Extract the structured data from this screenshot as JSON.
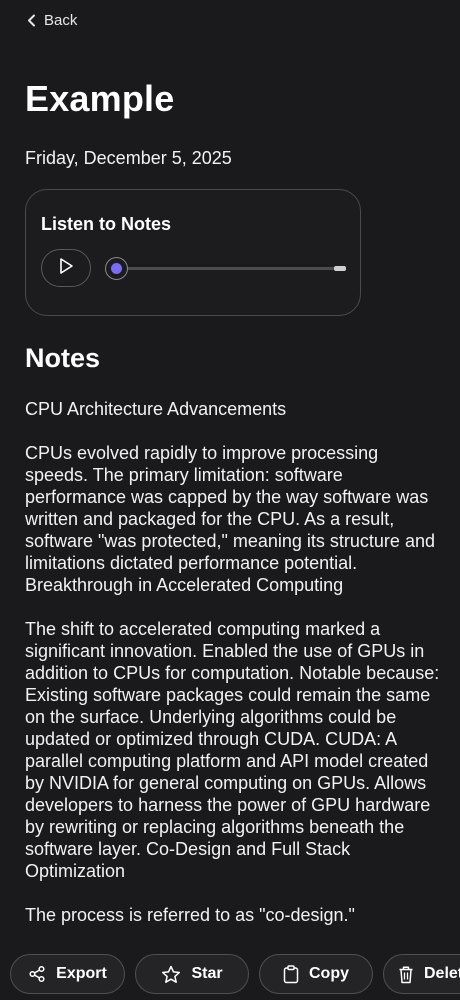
{
  "header": {
    "back_label": "Back"
  },
  "note": {
    "title": "Example",
    "date": "Friday, December 5, 2025"
  },
  "audio": {
    "title": "Listen to Notes",
    "progress": 0
  },
  "notes": {
    "heading": "Notes",
    "paragraphs": [
      "CPU Architecture Advancements",
      "CPUs evolved rapidly to improve processing speeds. The primary limitation: software performance was capped by the way software was written and packaged for the CPU. As a result, software \"was protected,\" meaning its structure and limitations dictated performance potential. Breakthrough in Accelerated Computing",
      "The shift to accelerated computing marked a significant innovation. Enabled the use of GPUs in addition to CPUs for computation. Notable because: Existing software packages could remain the same on the surface. Underlying algorithms could be updated or optimized through CUDA. CUDA: A parallel computing platform and API model created by NVIDIA for general computing on GPUs. Allows developers to harness the power of GPU hardware by rewriting or replacing algorithms beneath the software layer. Co-Design and Full Stack Optimization",
      "The process is referred to as \"co-design.\""
    ]
  },
  "toolbar": {
    "export_label": "Export",
    "star_label": "Star",
    "copy_label": "Copy",
    "delete_label": "Delete"
  },
  "colors": {
    "background": "#1a1a1c",
    "accent": "#7a6cf5"
  }
}
